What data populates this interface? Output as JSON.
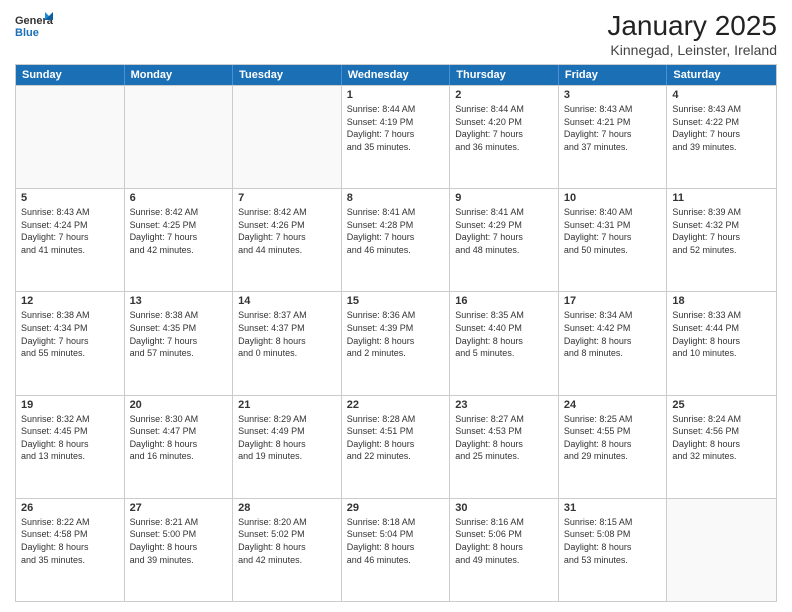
{
  "logo": {
    "line1": "General",
    "line2": "Blue"
  },
  "title": "January 2025",
  "subtitle": "Kinnegad, Leinster, Ireland",
  "weekdays": [
    "Sunday",
    "Monday",
    "Tuesday",
    "Wednesday",
    "Thursday",
    "Friday",
    "Saturday"
  ],
  "rows": [
    [
      {
        "day": "",
        "empty": true
      },
      {
        "day": "",
        "empty": true
      },
      {
        "day": "",
        "empty": true
      },
      {
        "day": "1",
        "info": "Sunrise: 8:44 AM\nSunset: 4:19 PM\nDaylight: 7 hours\nand 35 minutes."
      },
      {
        "day": "2",
        "info": "Sunrise: 8:44 AM\nSunset: 4:20 PM\nDaylight: 7 hours\nand 36 minutes."
      },
      {
        "day": "3",
        "info": "Sunrise: 8:43 AM\nSunset: 4:21 PM\nDaylight: 7 hours\nand 37 minutes."
      },
      {
        "day": "4",
        "info": "Sunrise: 8:43 AM\nSunset: 4:22 PM\nDaylight: 7 hours\nand 39 minutes."
      }
    ],
    [
      {
        "day": "5",
        "info": "Sunrise: 8:43 AM\nSunset: 4:24 PM\nDaylight: 7 hours\nand 41 minutes."
      },
      {
        "day": "6",
        "info": "Sunrise: 8:42 AM\nSunset: 4:25 PM\nDaylight: 7 hours\nand 42 minutes."
      },
      {
        "day": "7",
        "info": "Sunrise: 8:42 AM\nSunset: 4:26 PM\nDaylight: 7 hours\nand 44 minutes."
      },
      {
        "day": "8",
        "info": "Sunrise: 8:41 AM\nSunset: 4:28 PM\nDaylight: 7 hours\nand 46 minutes."
      },
      {
        "day": "9",
        "info": "Sunrise: 8:41 AM\nSunset: 4:29 PM\nDaylight: 7 hours\nand 48 minutes."
      },
      {
        "day": "10",
        "info": "Sunrise: 8:40 AM\nSunset: 4:31 PM\nDaylight: 7 hours\nand 50 minutes."
      },
      {
        "day": "11",
        "info": "Sunrise: 8:39 AM\nSunset: 4:32 PM\nDaylight: 7 hours\nand 52 minutes."
      }
    ],
    [
      {
        "day": "12",
        "info": "Sunrise: 8:38 AM\nSunset: 4:34 PM\nDaylight: 7 hours\nand 55 minutes."
      },
      {
        "day": "13",
        "info": "Sunrise: 8:38 AM\nSunset: 4:35 PM\nDaylight: 7 hours\nand 57 minutes."
      },
      {
        "day": "14",
        "info": "Sunrise: 8:37 AM\nSunset: 4:37 PM\nDaylight: 8 hours\nand 0 minutes."
      },
      {
        "day": "15",
        "info": "Sunrise: 8:36 AM\nSunset: 4:39 PM\nDaylight: 8 hours\nand 2 minutes."
      },
      {
        "day": "16",
        "info": "Sunrise: 8:35 AM\nSunset: 4:40 PM\nDaylight: 8 hours\nand 5 minutes."
      },
      {
        "day": "17",
        "info": "Sunrise: 8:34 AM\nSunset: 4:42 PM\nDaylight: 8 hours\nand 8 minutes."
      },
      {
        "day": "18",
        "info": "Sunrise: 8:33 AM\nSunset: 4:44 PM\nDaylight: 8 hours\nand 10 minutes."
      }
    ],
    [
      {
        "day": "19",
        "info": "Sunrise: 8:32 AM\nSunset: 4:45 PM\nDaylight: 8 hours\nand 13 minutes."
      },
      {
        "day": "20",
        "info": "Sunrise: 8:30 AM\nSunset: 4:47 PM\nDaylight: 8 hours\nand 16 minutes."
      },
      {
        "day": "21",
        "info": "Sunrise: 8:29 AM\nSunset: 4:49 PM\nDaylight: 8 hours\nand 19 minutes."
      },
      {
        "day": "22",
        "info": "Sunrise: 8:28 AM\nSunset: 4:51 PM\nDaylight: 8 hours\nand 22 minutes."
      },
      {
        "day": "23",
        "info": "Sunrise: 8:27 AM\nSunset: 4:53 PM\nDaylight: 8 hours\nand 25 minutes."
      },
      {
        "day": "24",
        "info": "Sunrise: 8:25 AM\nSunset: 4:55 PM\nDaylight: 8 hours\nand 29 minutes."
      },
      {
        "day": "25",
        "info": "Sunrise: 8:24 AM\nSunset: 4:56 PM\nDaylight: 8 hours\nand 32 minutes."
      }
    ],
    [
      {
        "day": "26",
        "info": "Sunrise: 8:22 AM\nSunset: 4:58 PM\nDaylight: 8 hours\nand 35 minutes."
      },
      {
        "day": "27",
        "info": "Sunrise: 8:21 AM\nSunset: 5:00 PM\nDaylight: 8 hours\nand 39 minutes."
      },
      {
        "day": "28",
        "info": "Sunrise: 8:20 AM\nSunset: 5:02 PM\nDaylight: 8 hours\nand 42 minutes."
      },
      {
        "day": "29",
        "info": "Sunrise: 8:18 AM\nSunset: 5:04 PM\nDaylight: 8 hours\nand 46 minutes."
      },
      {
        "day": "30",
        "info": "Sunrise: 8:16 AM\nSunset: 5:06 PM\nDaylight: 8 hours\nand 49 minutes."
      },
      {
        "day": "31",
        "info": "Sunrise: 8:15 AM\nSunset: 5:08 PM\nDaylight: 8 hours\nand 53 minutes."
      },
      {
        "day": "",
        "empty": true
      }
    ]
  ]
}
